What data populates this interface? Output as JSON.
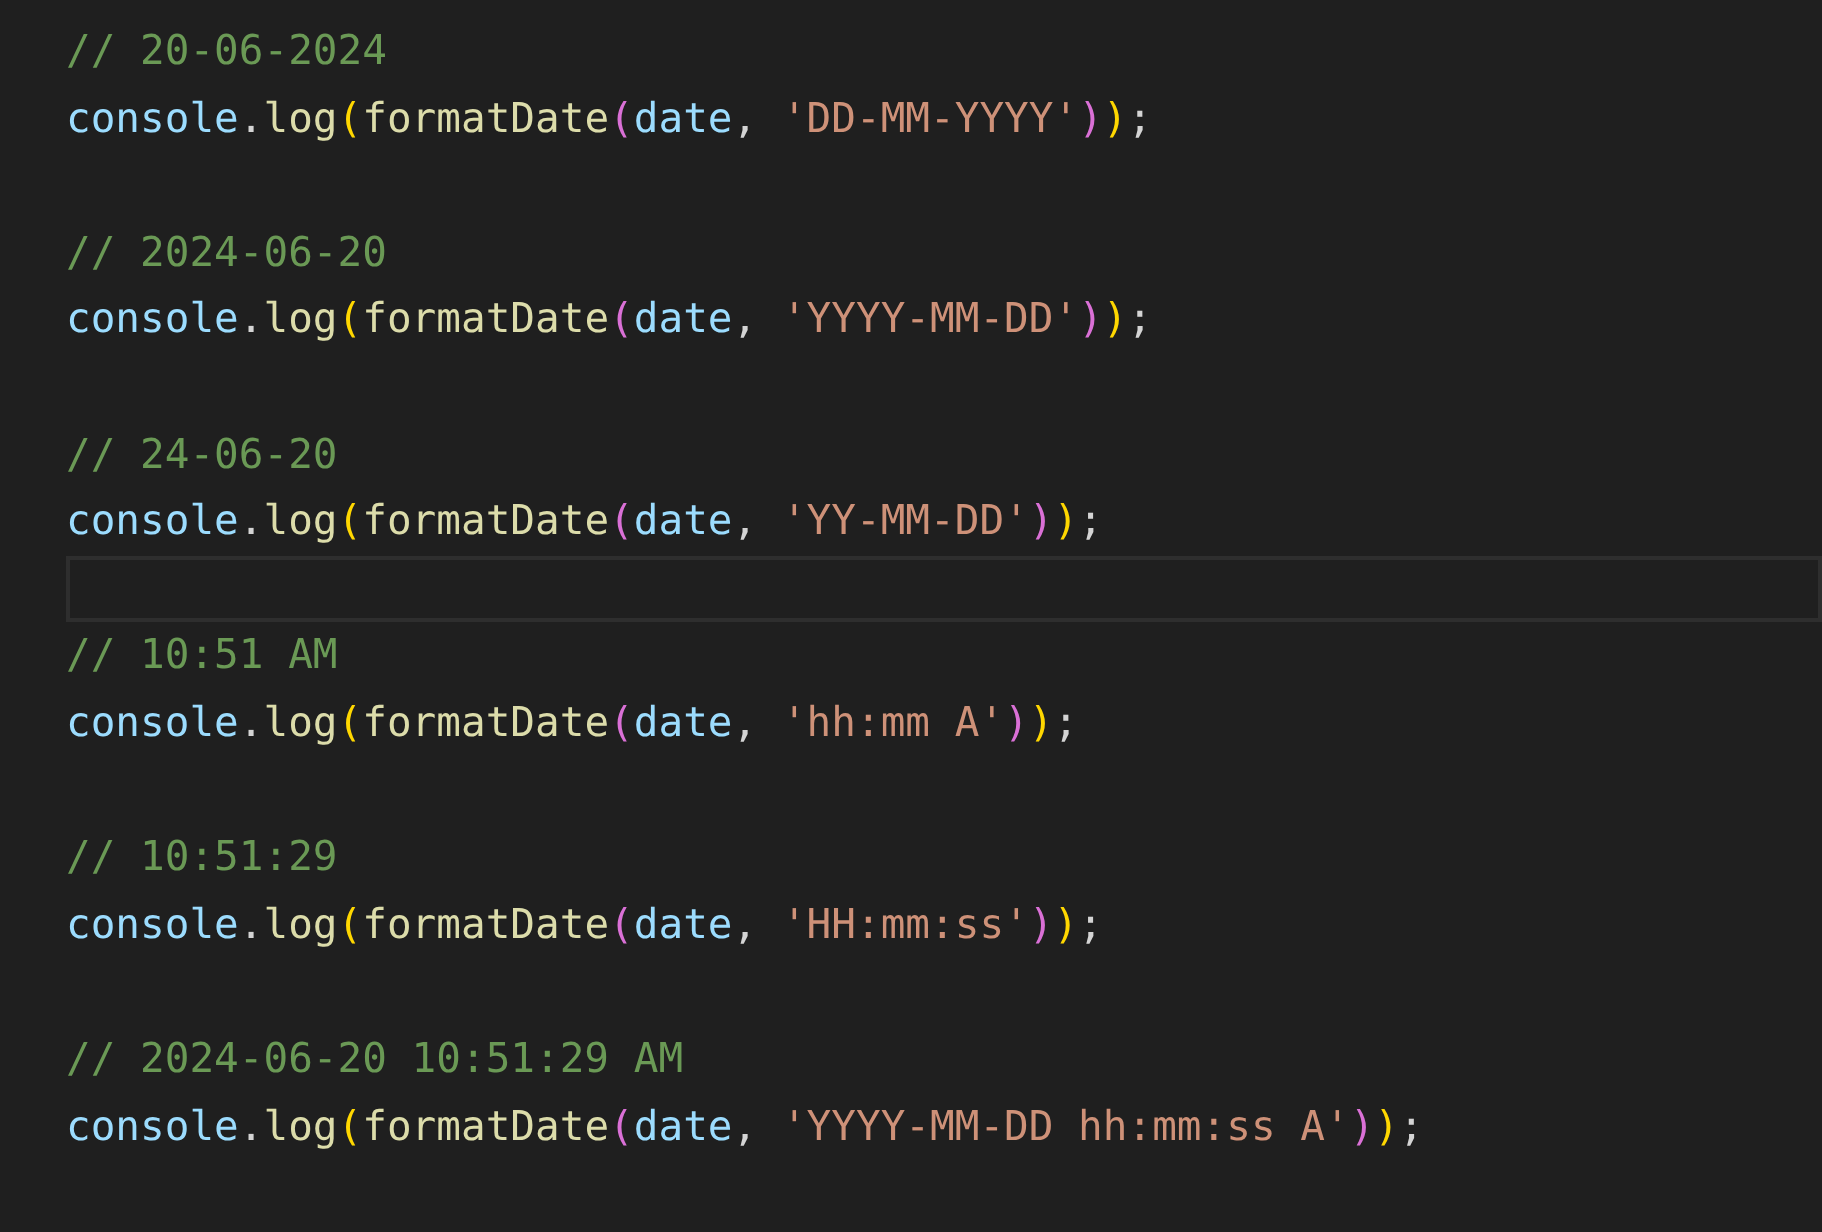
{
  "editor": {
    "lines": [
      {
        "current": false,
        "tokens": [
          {
            "kind": "comment",
            "text": "// 20-06-2024"
          }
        ]
      },
      {
        "current": false,
        "tokens": [
          {
            "kind": "variable",
            "text": "console"
          },
          {
            "kind": "punct",
            "text": "."
          },
          {
            "kind": "function",
            "text": "log"
          },
          {
            "kind": "bracket1",
            "text": "("
          },
          {
            "kind": "function",
            "text": "formatDate"
          },
          {
            "kind": "bracket2",
            "text": "("
          },
          {
            "kind": "variable",
            "text": "date"
          },
          {
            "kind": "punct",
            "text": ", "
          },
          {
            "kind": "string",
            "text": "'DD-MM-YYYY'"
          },
          {
            "kind": "bracket2",
            "text": ")"
          },
          {
            "kind": "bracket1",
            "text": ")"
          },
          {
            "kind": "punct",
            "text": ";"
          }
        ]
      },
      {
        "current": false
      },
      {
        "current": false,
        "tokens": [
          {
            "kind": "comment",
            "text": "// 2024-06-20"
          }
        ]
      },
      {
        "current": false,
        "tokens": [
          {
            "kind": "variable",
            "text": "console"
          },
          {
            "kind": "punct",
            "text": "."
          },
          {
            "kind": "function",
            "text": "log"
          },
          {
            "kind": "bracket1",
            "text": "("
          },
          {
            "kind": "function",
            "text": "formatDate"
          },
          {
            "kind": "bracket2",
            "text": "("
          },
          {
            "kind": "variable",
            "text": "date"
          },
          {
            "kind": "punct",
            "text": ", "
          },
          {
            "kind": "string",
            "text": "'YYYY-MM-DD'"
          },
          {
            "kind": "bracket2",
            "text": ")"
          },
          {
            "kind": "bracket1",
            "text": ")"
          },
          {
            "kind": "punct",
            "text": ";"
          }
        ]
      },
      {
        "current": false
      },
      {
        "current": false,
        "tokens": [
          {
            "kind": "comment",
            "text": "// 24-06-20"
          }
        ]
      },
      {
        "current": false,
        "tokens": [
          {
            "kind": "variable",
            "text": "console"
          },
          {
            "kind": "punct",
            "text": "."
          },
          {
            "kind": "function",
            "text": "log"
          },
          {
            "kind": "bracket1",
            "text": "("
          },
          {
            "kind": "function",
            "text": "formatDate"
          },
          {
            "kind": "bracket2",
            "text": "("
          },
          {
            "kind": "variable",
            "text": "date"
          },
          {
            "kind": "punct",
            "text": ", "
          },
          {
            "kind": "string",
            "text": "'YY-MM-DD'"
          },
          {
            "kind": "bracket2",
            "text": ")"
          },
          {
            "kind": "bracket1",
            "text": ")"
          },
          {
            "kind": "punct",
            "text": ";"
          }
        ]
      },
      {
        "current": true
      },
      {
        "current": false,
        "tokens": [
          {
            "kind": "comment",
            "text": "// 10:51 AM"
          }
        ]
      },
      {
        "current": false,
        "tokens": [
          {
            "kind": "variable",
            "text": "console"
          },
          {
            "kind": "punct",
            "text": "."
          },
          {
            "kind": "function",
            "text": "log"
          },
          {
            "kind": "bracket1",
            "text": "("
          },
          {
            "kind": "function",
            "text": "formatDate"
          },
          {
            "kind": "bracket2",
            "text": "("
          },
          {
            "kind": "variable",
            "text": "date"
          },
          {
            "kind": "punct",
            "text": ", "
          },
          {
            "kind": "string",
            "text": "'hh:mm A'"
          },
          {
            "kind": "bracket2",
            "text": ")"
          },
          {
            "kind": "bracket1",
            "text": ")"
          },
          {
            "kind": "punct",
            "text": ";"
          }
        ]
      },
      {
        "current": false
      },
      {
        "current": false,
        "tokens": [
          {
            "kind": "comment",
            "text": "// 10:51:29"
          }
        ]
      },
      {
        "current": false,
        "tokens": [
          {
            "kind": "variable",
            "text": "console"
          },
          {
            "kind": "punct",
            "text": "."
          },
          {
            "kind": "function",
            "text": "log"
          },
          {
            "kind": "bracket1",
            "text": "("
          },
          {
            "kind": "function",
            "text": "formatDate"
          },
          {
            "kind": "bracket2",
            "text": "("
          },
          {
            "kind": "variable",
            "text": "date"
          },
          {
            "kind": "punct",
            "text": ", "
          },
          {
            "kind": "string",
            "text": "'HH:mm:ss'"
          },
          {
            "kind": "bracket2",
            "text": ")"
          },
          {
            "kind": "bracket1",
            "text": ")"
          },
          {
            "kind": "punct",
            "text": ";"
          }
        ]
      },
      {
        "current": false
      },
      {
        "current": false,
        "tokens": [
          {
            "kind": "comment",
            "text": "// 2024-06-20 10:51:29 AM"
          }
        ]
      },
      {
        "current": false,
        "tokens": [
          {
            "kind": "variable",
            "text": "console"
          },
          {
            "kind": "punct",
            "text": "."
          },
          {
            "kind": "function",
            "text": "log"
          },
          {
            "kind": "bracket1",
            "text": "("
          },
          {
            "kind": "function",
            "text": "formatDate"
          },
          {
            "kind": "bracket2",
            "text": "("
          },
          {
            "kind": "variable",
            "text": "date"
          },
          {
            "kind": "punct",
            "text": ", "
          },
          {
            "kind": "string",
            "text": "'YYYY-MM-DD hh:mm:ss A'"
          },
          {
            "kind": "bracket2",
            "text": ")"
          },
          {
            "kind": "bracket1",
            "text": ")"
          },
          {
            "kind": "punct",
            "text": ";"
          }
        ]
      }
    ]
  }
}
